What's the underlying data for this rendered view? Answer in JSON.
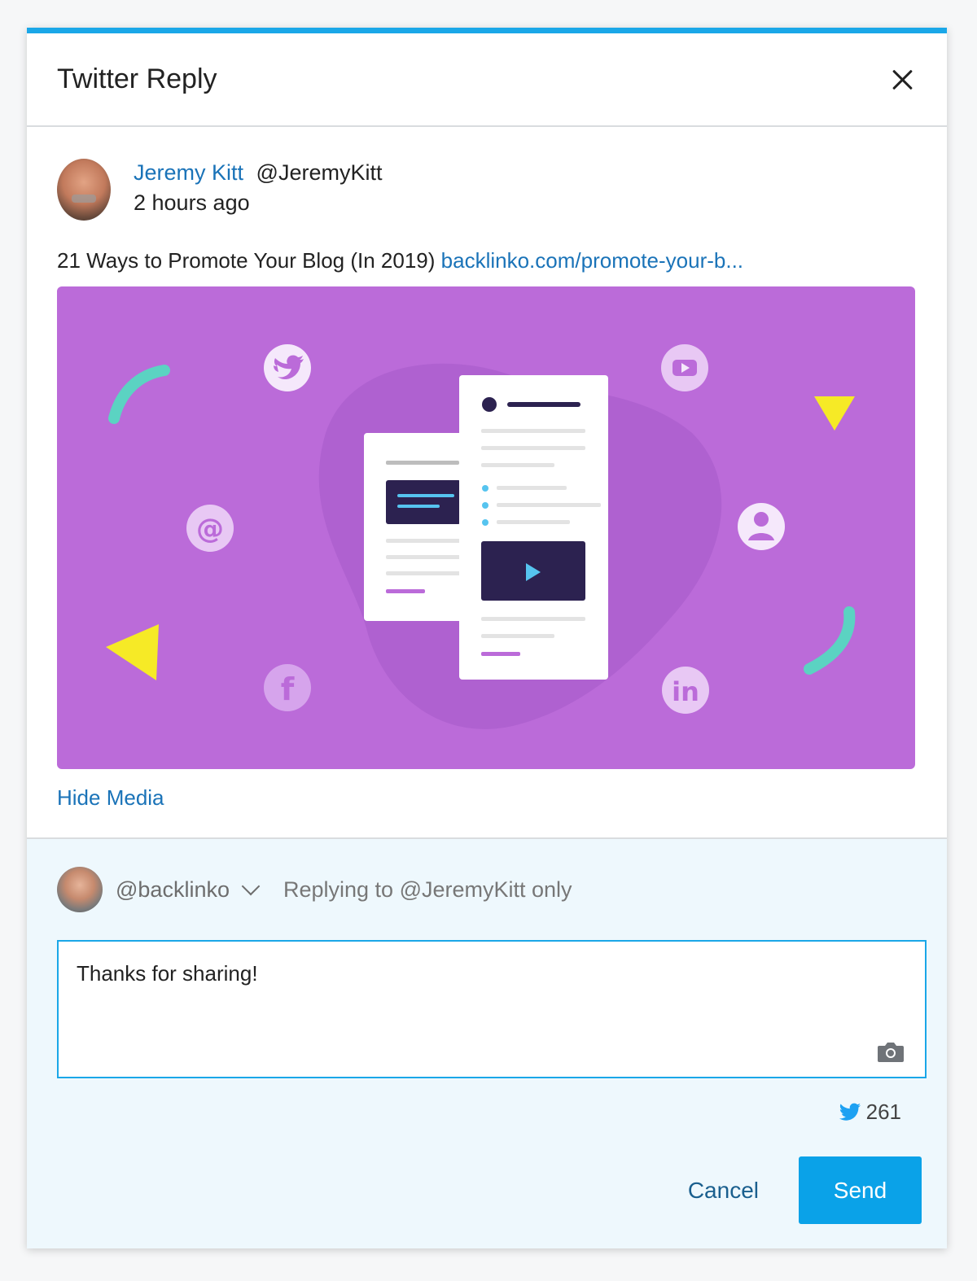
{
  "modal": {
    "title": "Twitter Reply",
    "accent": "#1aa7e8"
  },
  "tweet": {
    "author_name": "Jeremy Kitt",
    "author_handle": "@JeremyKitt",
    "time": "2 hours ago",
    "text": "21 Ways to Promote Your Blog (In 2019)",
    "link": "backlinko.com/promote-your-b...",
    "media_bg": "#bb6bd9",
    "hide_media_label": "Hide Media"
  },
  "reply": {
    "account": "@backlinko",
    "replying_to": "Replying to @JeremyKitt only",
    "text": "Thanks for sharing!",
    "char_count": "261",
    "cancel_label": "Cancel",
    "send_label": "Send",
    "send_color": "#0aa2e8"
  }
}
